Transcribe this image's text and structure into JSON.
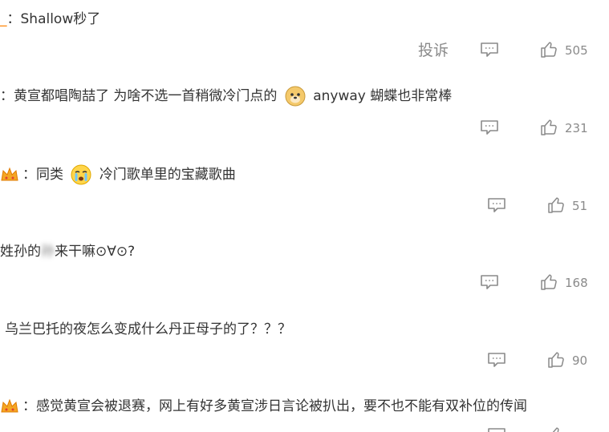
{
  "comments": [
    {
      "prefix": "_",
      "text": "：Shallow秒了",
      "report_label": "投诉",
      "likes": "505"
    },
    {
      "prefix": "",
      "text": "：黄宣都唱陶喆了 为啥不选一首稍微冷门点的",
      "text_after": "anyway 蝴蝶也非常棒",
      "likes": "231"
    },
    {
      "prefix": "",
      "text": "：同类",
      "text_after": "冷门歌单里的宝藏歌曲",
      "likes": "51"
    },
    {
      "text_a": "姓孙的",
      "text_blur": "孙",
      "text_b": "来干嘛⊙∀⊙?",
      "likes": "168"
    },
    {
      "text": "乌兰巴托的夜怎么变成什么丹正母子的了？？？",
      "likes": "90"
    },
    {
      "text": "：感觉黄宣会被退赛，网上有好多黄宣涉日言论被扒出，要不也不能有双补位的传闻"
    }
  ],
  "icons": {
    "reply": "reply-comment-icon",
    "like": "thumbs-up-icon",
    "badge": "fan-crown-badge-icon",
    "emoji_doge": "doge-emoji",
    "emoji_cry": "crying-emoji"
  },
  "colors": {
    "text": "#333333",
    "meta": "#8a8a8a",
    "accent": "#ff8200"
  }
}
